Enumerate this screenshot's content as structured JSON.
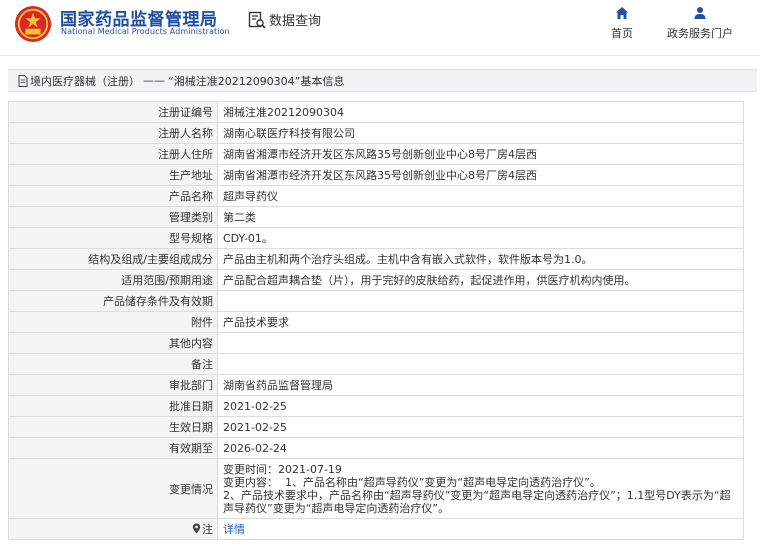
{
  "header": {
    "site_name_cn": "国家药品监督管理局",
    "site_name_en": "National Medical Products Administration",
    "query_label": "数据查询",
    "nav": [
      {
        "label": "首页",
        "icon": "home-icon"
      },
      {
        "label": "政务服务门户",
        "icon": "user-icon"
      }
    ]
  },
  "title_bar": {
    "category": "境内医疗器械（注册）",
    "separator": "——",
    "subtitle": "“湘械注准20212090304”基本信息"
  },
  "rows": [
    {
      "key": "注册证编号",
      "value": "湘械注准20212090304"
    },
    {
      "key": "注册人名称",
      "value": "湖南心联医疗科技有限公司"
    },
    {
      "key": "注册人住所",
      "value": "湖南省湘潭市经济开发区东风路35号创新创业中心8号厂房4层西"
    },
    {
      "key": "生产地址",
      "value": "湖南省湘潭市经济开发区东风路35号创新创业中心8号厂房4层西"
    },
    {
      "key": "产品名称",
      "value": "超声导药仪"
    },
    {
      "key": "管理类别",
      "value": "第二类"
    },
    {
      "key": "型号规格",
      "value": "CDY-01。"
    },
    {
      "key": "结构及组成/主要组成成分",
      "value": "产品由主机和两个治疗头组成。主机中含有嵌入式软件，软件版本号为1.0。"
    },
    {
      "key": "适用范围/预期用途",
      "value": "产品配合超声耦合垫（片），用于完好的皮肤给药，起促进作用，供医疗机构内使用。"
    },
    {
      "key": "产品储存条件及有效期",
      "value": ""
    },
    {
      "key": "附件",
      "value": "产品技术要求"
    },
    {
      "key": "其他内容",
      "value": ""
    },
    {
      "key": "备注",
      "value": ""
    },
    {
      "key": "审批部门",
      "value": "湖南省药品监督管理局"
    },
    {
      "key": "批准日期",
      "value": "2021-02-25"
    },
    {
      "key": "生效日期",
      "value": "2021-02-25"
    },
    {
      "key": "有效期至",
      "value": "2026-02-24"
    }
  ],
  "change": {
    "key": "变更情况",
    "lines": [
      "变更时间：2021-07-19",
      "变更内容：  1、产品名称由“超声导药仪”变更为“超声电导定向透药治疗仪”。",
      "2、产品技术要求中，产品名称由“超声导药仪”变更为“超声电导定向透药治疗仪”；1.1型号DY表示为“超声导药仪”变更为“超声电导定向透药治疗仪”。"
    ]
  },
  "note": {
    "key": "注",
    "link": "详情"
  },
  "colors": {
    "brand_blue": "#1e4fa3",
    "link_blue": "#1e5fb3",
    "key_bg": "#f4f4f4",
    "border": "#dcdcdc"
  }
}
